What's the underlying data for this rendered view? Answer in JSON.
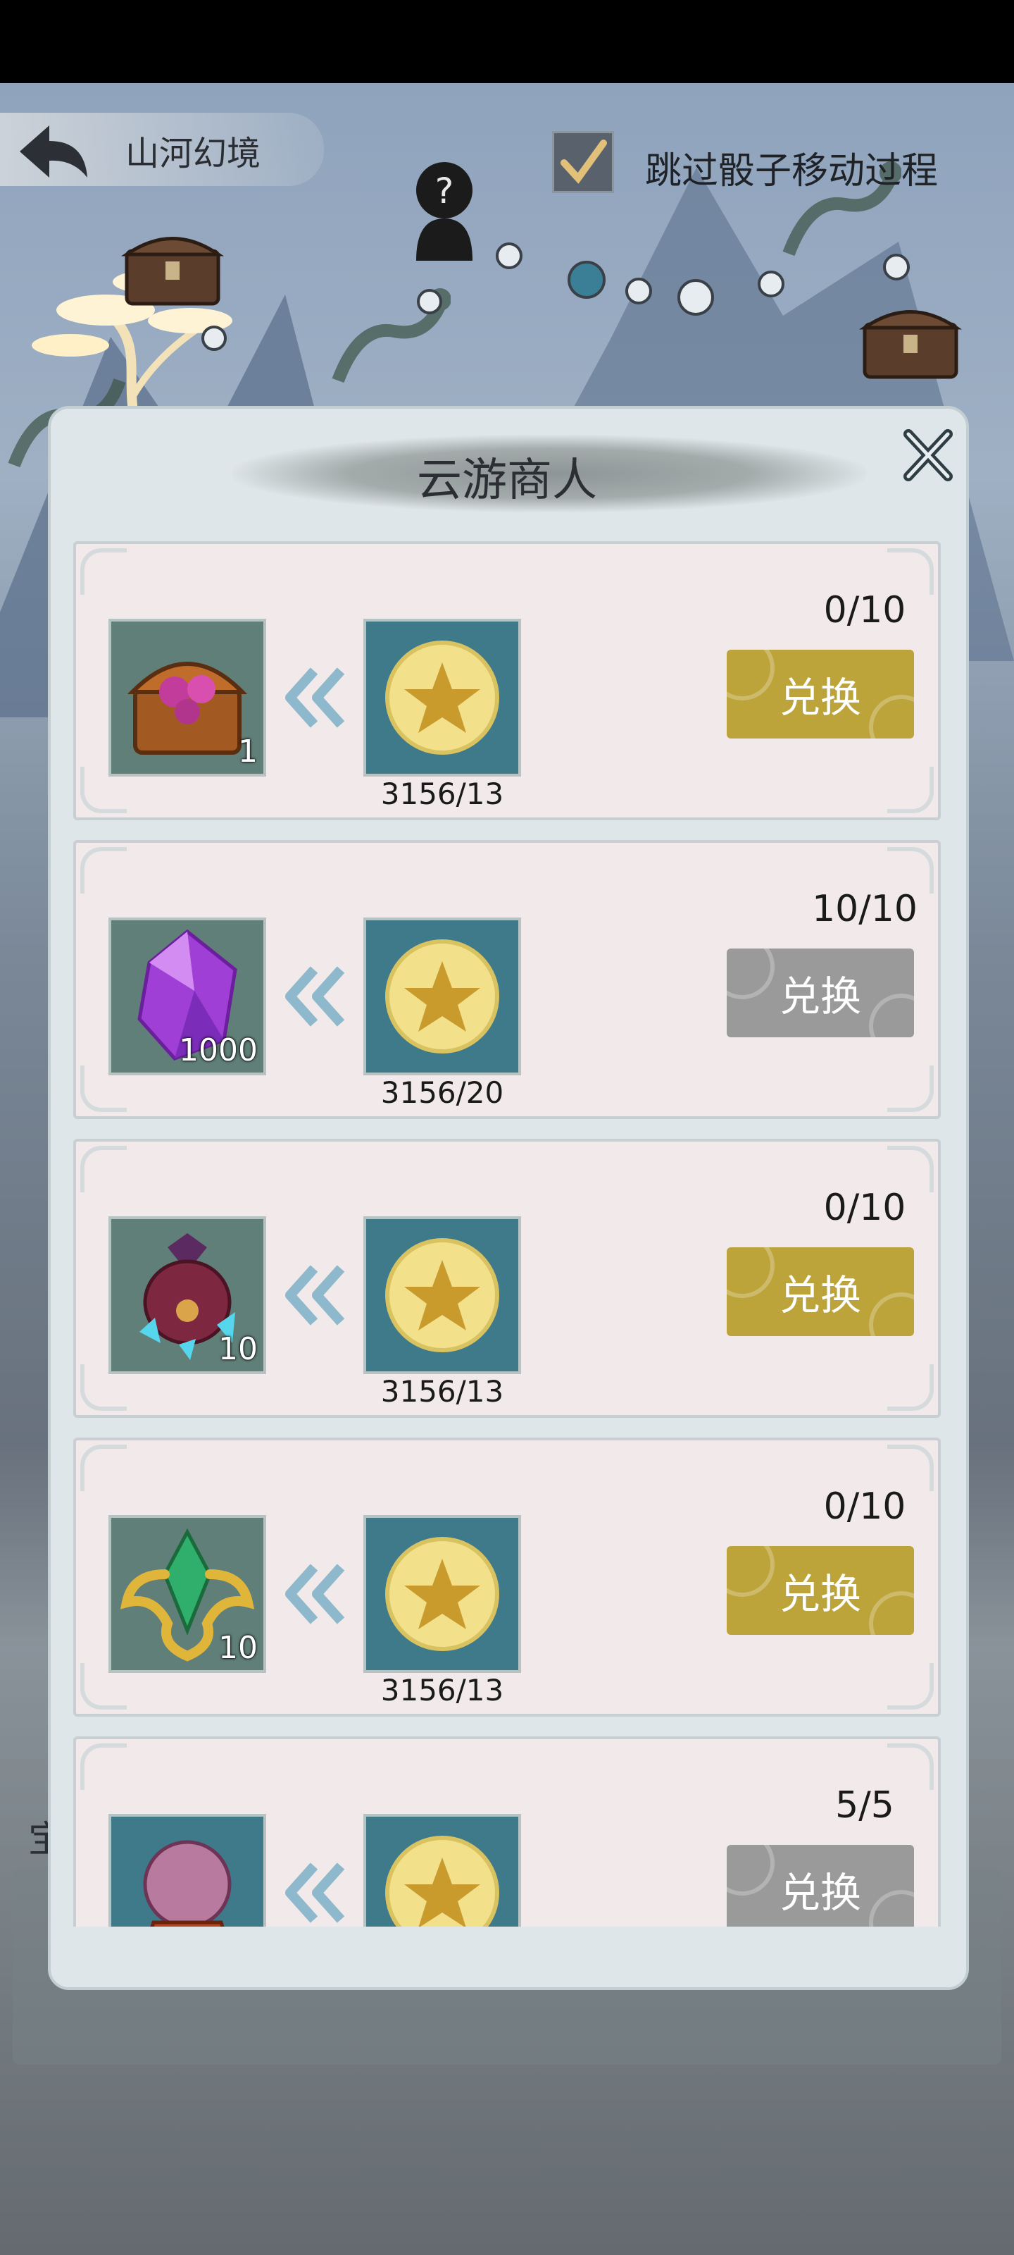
{
  "header": {
    "title": "山河幻境",
    "skip_label": "跳过骰子移动过程",
    "skip_checked": true
  },
  "modal": {
    "title": "云游商人",
    "button_label": "兑换"
  },
  "side_text": "宝",
  "items": [
    {
      "name": "treasure-chest",
      "qty": "1",
      "cost": "3156/13",
      "limit": "0/10",
      "enabled": true
    },
    {
      "name": "purple-crystal",
      "qty": "1000",
      "cost": "3156/20",
      "limit": "10/10",
      "enabled": false
    },
    {
      "name": "crystal-pouch",
      "qty": "10",
      "cost": "3156/13",
      "limit": "0/10",
      "enabled": true
    },
    {
      "name": "emerald-emblem",
      "qty": "10",
      "cost": "3156/13",
      "limit": "0/10",
      "enabled": true
    },
    {
      "name": "crystal-orb",
      "qty": "",
      "cost": "",
      "limit": "5/5",
      "enabled": false
    }
  ],
  "colors": {
    "button_active": "#bca43a",
    "button_disabled": "#9a9a9a",
    "icon_bg": "#607f78",
    "coin_bg": "#3f7a8a"
  }
}
